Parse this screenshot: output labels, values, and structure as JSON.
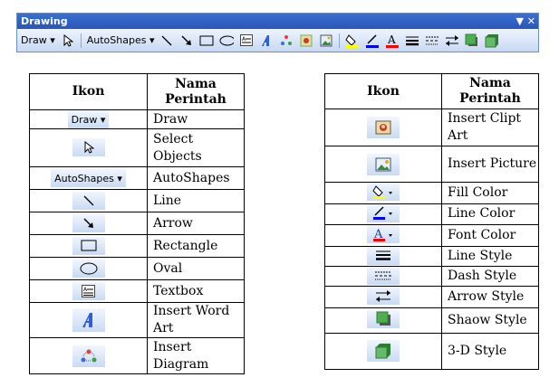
{
  "toolbar": {
    "title": "Drawing",
    "draw_label": "Draw ▾",
    "autoshapes_label": "AutoShapes ▾",
    "menu_icon": "▼",
    "close_icon": "✕"
  },
  "left_table": {
    "header_icon": "Ikon",
    "header_name": "Nama Perintah",
    "rows": [
      {
        "icon": "draw-menu-icon",
        "label": "Draw"
      },
      {
        "icon": "select-objects-icon",
        "label": "Select Objects"
      },
      {
        "icon": "autoshapes-menu-icon",
        "label": "AutoShapes"
      },
      {
        "icon": "line-icon",
        "label": "Line"
      },
      {
        "icon": "arrow-icon",
        "label": "Arrow"
      },
      {
        "icon": "rectangle-icon",
        "label": "Rectangle"
      },
      {
        "icon": "oval-icon",
        "label": "Oval"
      },
      {
        "icon": "textbox-icon",
        "label": "Textbox"
      },
      {
        "icon": "wordart-icon",
        "label": "Insert Word Art"
      },
      {
        "icon": "diagram-icon",
        "label": "Insert Diagram"
      }
    ]
  },
  "right_table": {
    "header_icon": "Ikon",
    "header_name": "Nama Perintah",
    "rows": [
      {
        "icon": "clipart-icon",
        "label": "Insert Clipt Art"
      },
      {
        "icon": "picture-icon",
        "label": "Insert Picture"
      },
      {
        "icon": "fill-color-icon",
        "label": "Fill Color"
      },
      {
        "icon": "line-color-icon",
        "label": "Line Color"
      },
      {
        "icon": "font-color-icon",
        "label": "Font Color"
      },
      {
        "icon": "line-style-icon",
        "label": "Line Style"
      },
      {
        "icon": "dash-style-icon",
        "label": "Dash Style"
      },
      {
        "icon": "arrow-style-icon",
        "label": "Arrow Style"
      },
      {
        "icon": "shadow-style-icon",
        "label": "Shaow Style"
      },
      {
        "icon": "3d-style-icon",
        "label": "3-D Style"
      }
    ]
  },
  "colors": {
    "toolbar_title_bg": "#2a56b8",
    "icon_button_bg": "#c9daf3",
    "fill_color": "#ffff00",
    "line_color": "#0000ff",
    "font_color": "#ff0000",
    "shape_green": "#4caf50"
  }
}
